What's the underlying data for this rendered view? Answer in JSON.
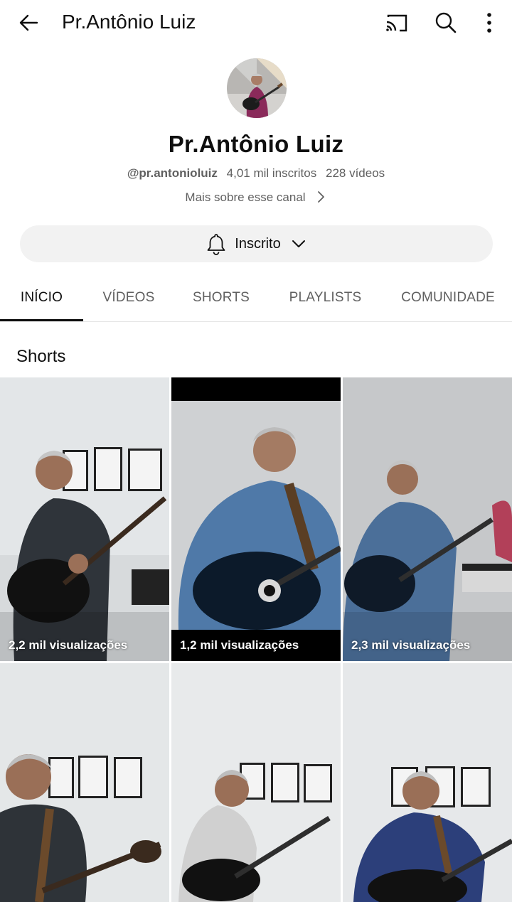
{
  "appbar": {
    "title": "Pr.Antônio Luiz",
    "icons": [
      "back-arrow-icon",
      "cast-icon",
      "search-icon",
      "more-vert-icon"
    ]
  },
  "channel": {
    "name": "Pr.Antônio Luiz",
    "handle": "@pr.antonioluiz",
    "subscribers": "4,01 mil inscritos",
    "videos": "228 vídeos",
    "about_link": "Mais sobre esse canal"
  },
  "subscribe": {
    "label": "Inscrito"
  },
  "tabs": [
    {
      "label": "INÍCIO",
      "active": true
    },
    {
      "label": "VÍDEOS",
      "active": false
    },
    {
      "label": "SHORTS",
      "active": false
    },
    {
      "label": "PLAYLISTS",
      "active": false
    },
    {
      "label": "COMUNIDADE",
      "active": false
    }
  ],
  "section": {
    "title": "Shorts"
  },
  "shorts": [
    {
      "views": "2,2 mil visualizações"
    },
    {
      "views": "1,2 mil visualizações"
    },
    {
      "views": "2,3 mil visualizações"
    },
    {
      "views": ""
    },
    {
      "views": ""
    },
    {
      "views": ""
    }
  ],
  "colors": {
    "text_primary": "#0f0f0f",
    "text_secondary": "#606060",
    "button_bg": "#f2f2f2",
    "divider": "#e5e5e5"
  }
}
